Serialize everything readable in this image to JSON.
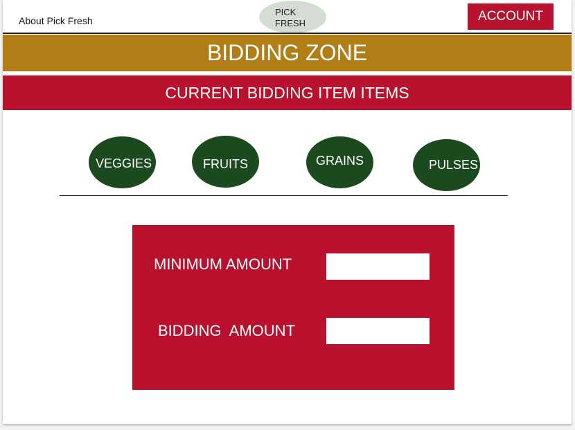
{
  "header": {
    "about_link": "About Pick Fresh",
    "logo_line1": "PICK",
    "logo_line2": "FRESH",
    "account_label": "ACCOUNT"
  },
  "banners": {
    "zone_title": "BIDDING ZONE",
    "items_title": "CURRENT BIDDING ITEM ITEMS"
  },
  "categories": [
    {
      "label": "VEGGIES"
    },
    {
      "label": "FRUITS"
    },
    {
      "label": "GRAINS"
    },
    {
      "label": "PULSES"
    }
  ],
  "bid_form": {
    "minimum_label": "MINIMUM AMOUNT",
    "minimum_value": "",
    "bidding_label": "BIDDING  AMOUNT",
    "bidding_value": ""
  },
  "colors": {
    "zone_banner": "#b07d17",
    "accent_red": "#b9122e",
    "category_green": "#1c4a1f",
    "logo_oval": "#d4dcd3"
  }
}
